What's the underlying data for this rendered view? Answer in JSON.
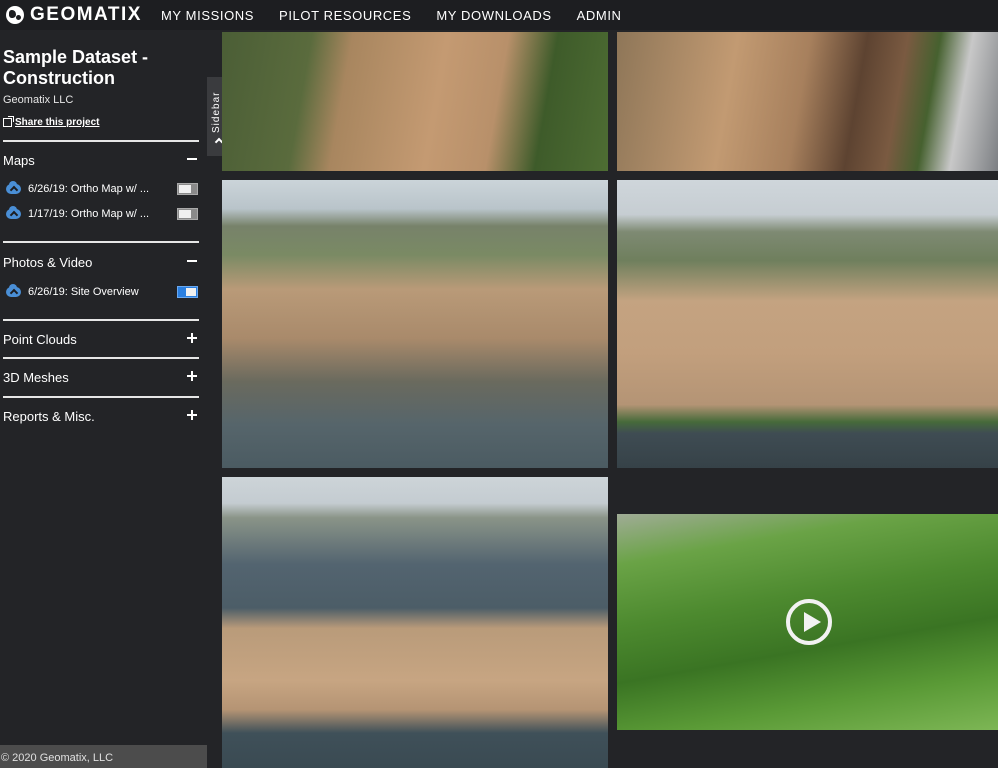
{
  "app": {
    "brand": "GEOMATIX",
    "nav": [
      "MY MISSIONS",
      "PILOT RESOURCES",
      "MY DOWNLOADS",
      "ADMIN"
    ]
  },
  "sidebar": {
    "title": "Sample Dataset - Construction",
    "org": "Geomatix LLC",
    "share_label": "Share this project",
    "sections": {
      "maps": {
        "label": "Maps",
        "expanded": true,
        "items": [
          {
            "label": "6/26/19: Ortho Map w/ ...",
            "visible": false
          },
          {
            "label": "1/17/19: Ortho Map w/ ...",
            "visible": false
          }
        ]
      },
      "photos": {
        "label": "Photos & Video",
        "expanded": true,
        "items": [
          {
            "label": "6/26/19: Site Overview",
            "visible": true
          }
        ]
      },
      "point_clouds": {
        "label": "Point Clouds",
        "expanded": false
      },
      "meshes": {
        "label": "3D Meshes",
        "expanded": false
      },
      "reports": {
        "label": "Reports & Misc.",
        "expanded": false
      }
    },
    "tab_label": "Sidebar",
    "footer": "© 2020 Geomatix, LLC"
  },
  "icons": {
    "logo": "globe-icon",
    "share": "external-link-icon",
    "layer": "cloud-download-icon",
    "expanded": "minus-icon",
    "collapsed": "plus-icon",
    "video": "play-icon"
  },
  "colors": {
    "background": "#232427",
    "topbar": "#1d1e21",
    "accent": "#2a7fe0",
    "footer": "#4c4c4c"
  }
}
